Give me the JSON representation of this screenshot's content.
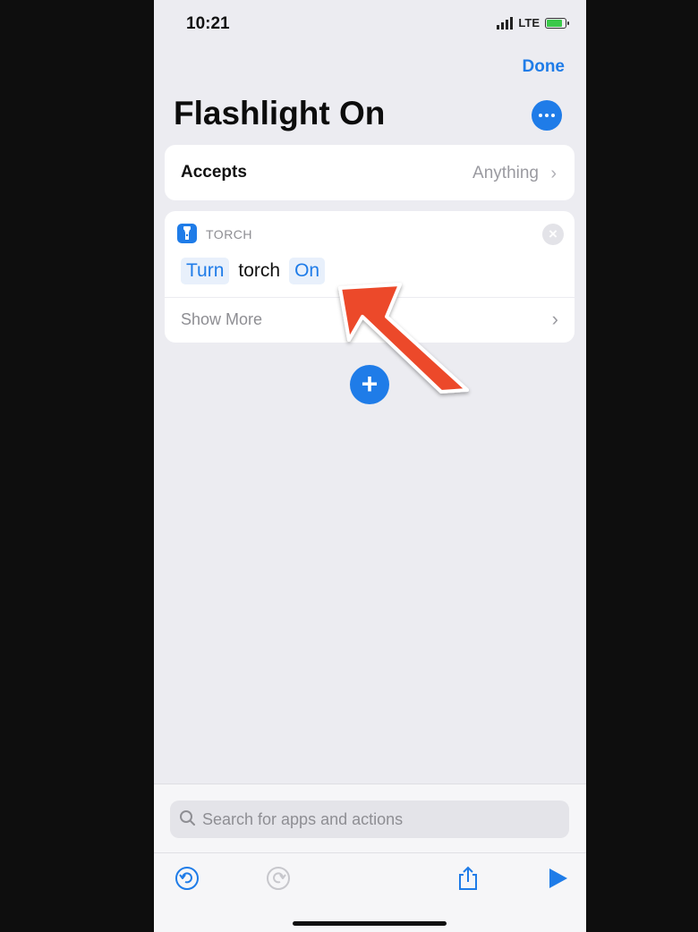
{
  "status_bar": {
    "time": "10:21",
    "network": "LTE"
  },
  "header": {
    "done_label": "Done",
    "title": "Flashlight On",
    "more_icon": "ellipsis-icon"
  },
  "accepts": {
    "label": "Accepts",
    "value": "Anything"
  },
  "action": {
    "category": "TORCH",
    "verb_token": "Turn",
    "object_text": "torch",
    "state_token": "On",
    "show_more_label": "Show More"
  },
  "search": {
    "placeholder": "Search for apps and actions",
    "value": ""
  },
  "toolbar": {
    "icons": [
      "undo-icon",
      "redo-icon",
      "share-icon",
      "play-icon"
    ]
  },
  "colors": {
    "accent": "#1f7ce8",
    "annotation_arrow": "#ec4a2c"
  }
}
